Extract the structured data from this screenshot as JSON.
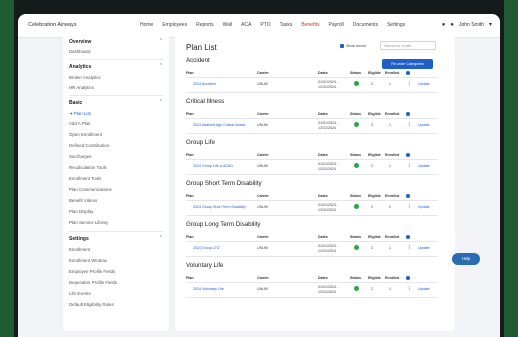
{
  "app": {
    "brand": "Celebration Airways"
  },
  "nav": [
    "Home",
    "Employees",
    "Reports",
    "Wall",
    "ACA",
    "PTO",
    "Tasks",
    "Benefits",
    "Payroll",
    "Documents",
    "Settings"
  ],
  "nav_active": "Benefits",
  "user": {
    "name": "John Smith"
  },
  "sidebar": {
    "overview": {
      "title": "Overview",
      "items": [
        "Dashboard"
      ]
    },
    "analytics": {
      "title": "Analytics",
      "items": [
        "Broker Analytics",
        "HR Analytics"
      ]
    },
    "basic": {
      "title": "Basic",
      "items": [
        "Plan List",
        "Add A Plan",
        "Open Enrollment",
        "Defined Contribution",
        "Surcharges",
        "Recalculation Tools",
        "Enrollment Tools",
        "Plan Communications",
        "Benefit Videos",
        "Plan Display",
        "Plan Service Library"
      ]
    },
    "settings": {
      "title": "Settings",
      "items": [
        "Enrollment",
        "Enrollment Window",
        "Employee Profile Fields",
        "Dependent Profile Fields",
        "Life Events",
        "Default Eligibility Rules"
      ]
    }
  },
  "main": {
    "title": "Plan List",
    "show_recent": "Show recent",
    "search_placeholder": "Search for a plan...",
    "reorder_button": "Re-order Categories",
    "columns": {
      "plan": "Plan",
      "carrier": "Carrier",
      "dates": "Dates",
      "status": "Status",
      "eligible": "Eligible",
      "enrolled": "Enrolled"
    },
    "update_label": "Update",
    "sections": [
      {
        "title": "Accident",
        "plan": "2024 Accident",
        "carrier": "UNUM",
        "date_start": "01/01/2024 -",
        "date_end": "12/31/2024",
        "eligible": "2",
        "enrolled": "1"
      },
      {
        "title": "Critical Illness",
        "plan": "2024 Attained Age Critical Illness",
        "carrier": "UNUM",
        "date_start": "01/01/2024 -",
        "date_end": "12/31/2024",
        "eligible": "3",
        "enrolled": "1"
      },
      {
        "title": "Group Life",
        "plan": "2024 Group Life & AD&D",
        "carrier": "UNUM",
        "date_start": "01/01/2024 -",
        "date_end": "12/31/2024",
        "eligible": "2",
        "enrolled": "1"
      },
      {
        "title": "Group Short Term Disability",
        "plan": "2024 Group Short Term Disability",
        "carrier": "UNUM",
        "date_start": "01/01/2024 -",
        "date_end": "12/31/2024",
        "eligible": "2",
        "enrolled": "2"
      },
      {
        "title": "Group Long Term Disability",
        "plan": "2024 Group LTD",
        "carrier": "UNUM",
        "date_start": "01/01/2024 -",
        "date_end": "12/31/2024",
        "eligible": "2",
        "enrolled": "1"
      },
      {
        "title": "Voluntary Life",
        "plan": "2024 Voluntary Life",
        "carrier": "UNUM",
        "date_start": "01/01/2024 -",
        "date_end": "12/31/2024",
        "eligible": "2",
        "enrolled": "1"
      }
    ]
  },
  "help": {
    "label": "Help"
  },
  "colors": {
    "accent": "#1e60c8",
    "active_nav": "#c0392b",
    "status_ok": "#27a844"
  }
}
